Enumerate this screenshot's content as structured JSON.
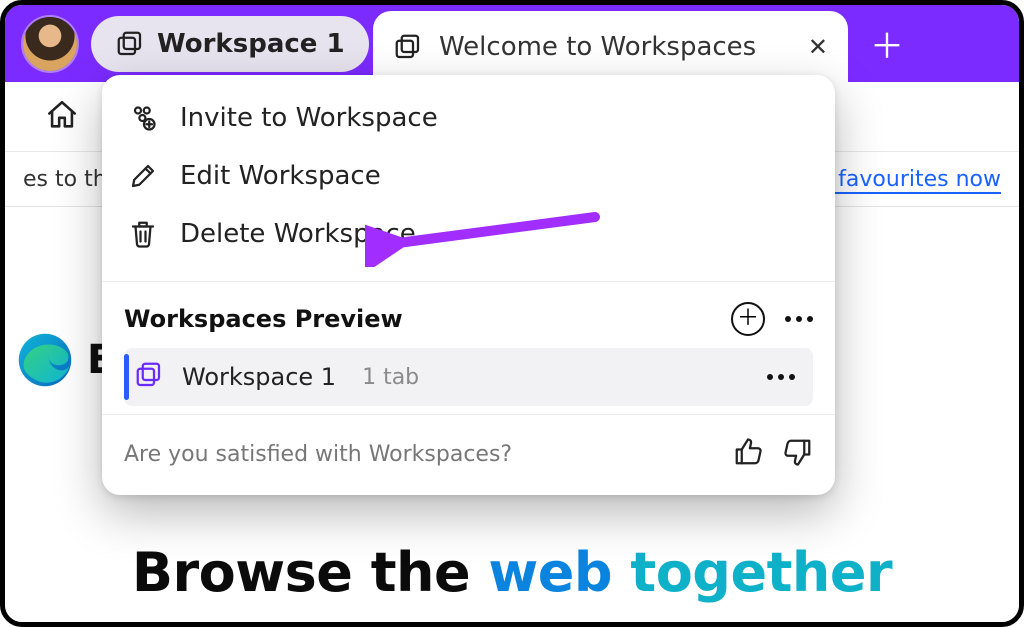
{
  "titlebar": {
    "workspace_chip": "Workspace 1",
    "tab_title": "Welcome to Workspaces"
  },
  "infobar": {
    "left_fragment": "es to this",
    "link_fragment": "e favourites now"
  },
  "page": {
    "edge_text_fragment": "E",
    "headline_plain": "Browse the ",
    "headline_blue": "web ",
    "headline_teal": "together"
  },
  "popover": {
    "menu": {
      "invite": "Invite to Workspace",
      "edit": "Edit Workspace",
      "delete": "Delete Workspace"
    },
    "preview_title": "Workspaces Preview",
    "workspace": {
      "name": "Workspace 1",
      "count_label": "1 tab"
    },
    "feedback_question": "Are you satisfied with Workspaces?"
  }
}
